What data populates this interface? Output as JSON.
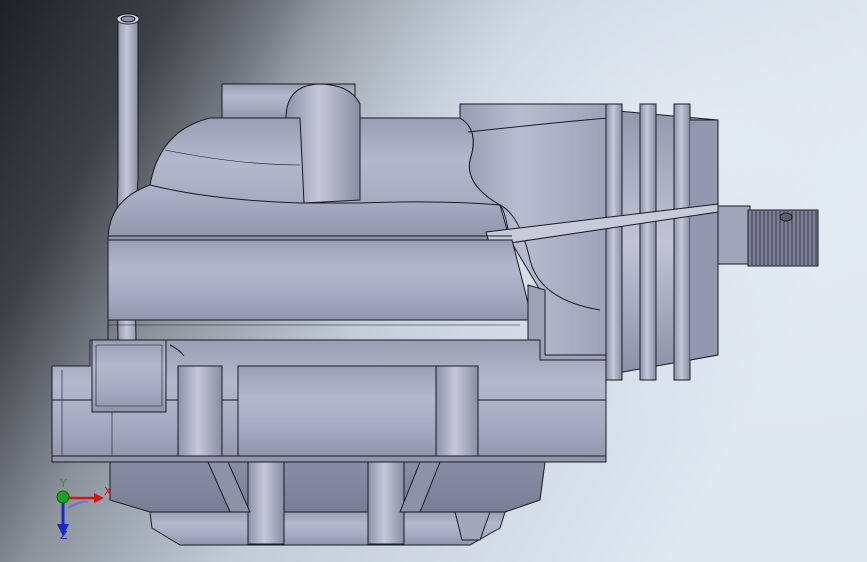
{
  "viewport": {
    "background_colors": [
      "#1e2023",
      "#8a9099",
      "#c8d3e2",
      "#dde6f1"
    ],
    "part_color": "#a9adc3"
  },
  "triad": {
    "x_label": "X",
    "y_label": "Y",
    "z_label": "Z",
    "x_color": "#d01616",
    "y_color": "#1ea01e",
    "z_color": "#1828c8"
  }
}
